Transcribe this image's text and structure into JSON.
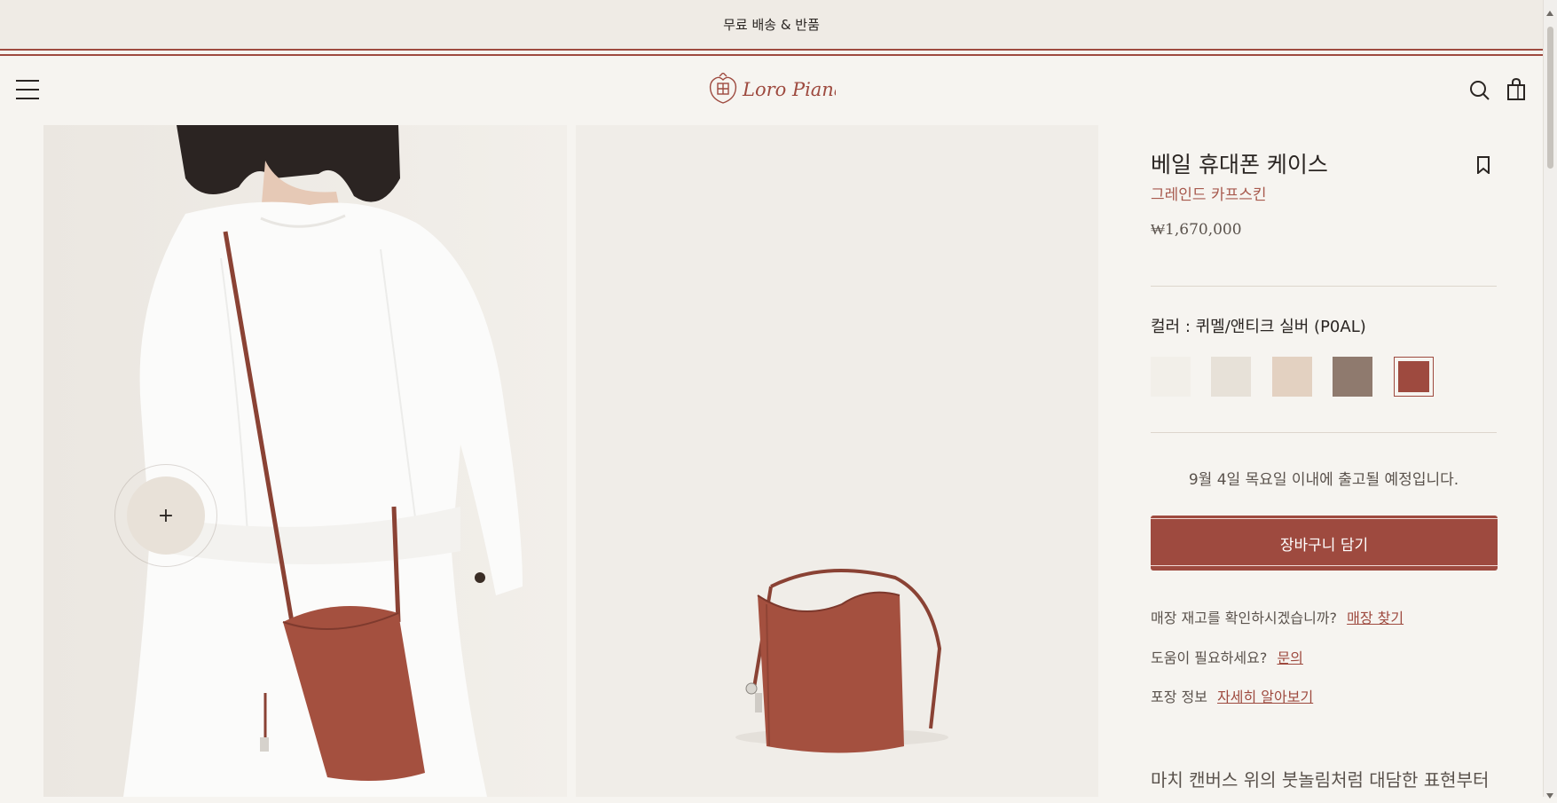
{
  "announcement": "무료 배송 & 반품",
  "brand": "Loro Piana",
  "product": {
    "title": "베일 휴대폰 케이스",
    "material": "그레인드 카프스킨",
    "price": "₩1,670,000",
    "color_label": "컬러 : 퀴멜/앤티크 실버 (P0AL)",
    "swatches": [
      {
        "color": "#f2efe9"
      },
      {
        "color": "#e7e1d8"
      },
      {
        "color": "#e3d1c1"
      },
      {
        "color": "#8f7a6e"
      },
      {
        "color": "#9e4a3f",
        "selected": true
      }
    ],
    "shipping_note": "9월 4일 목요일 이내에 출고될 예정입니다.",
    "add_to_cart": "장바구니 담기",
    "store_question": "매장 재고를 확인하시겠습니까?",
    "store_link": "매장 찾기",
    "help_question": "도움이 필요하세요?",
    "help_link": "문의",
    "packaging_label": "포장 정보",
    "packaging_link": "자세히 알아보기",
    "description": "마치 캔버스 위의 붓놀림처럼 대담한 표현부터"
  },
  "zoom_symbol": "+",
  "colors": {
    "accent": "#9e4a3f",
    "background": "#f6f4f0"
  }
}
